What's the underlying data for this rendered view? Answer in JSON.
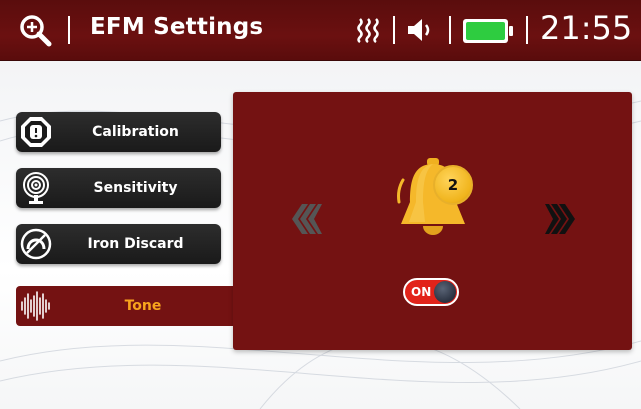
{
  "header": {
    "title": "EFM Settings",
    "time": "21:55",
    "icons": [
      "zoom-icon",
      "signal-icon",
      "volume-icon",
      "battery-icon"
    ],
    "battery_color": "#2ecc40"
  },
  "sidebar": {
    "items": [
      {
        "label": "Calibration",
        "icon": "calibration-icon",
        "active": false
      },
      {
        "label": "Sensitivity",
        "icon": "sensitivity-icon",
        "active": false
      },
      {
        "label": "Iron Discard",
        "icon": "iron-discard-icon",
        "active": false
      },
      {
        "label": "Tone",
        "icon": "tone-waveform-icon",
        "active": true
      }
    ]
  },
  "tone_panel": {
    "tone_number": "2",
    "toggle_label": "ON",
    "toggle_state": true,
    "accent_color": "#741212",
    "bell_color": "#f5b82a"
  }
}
